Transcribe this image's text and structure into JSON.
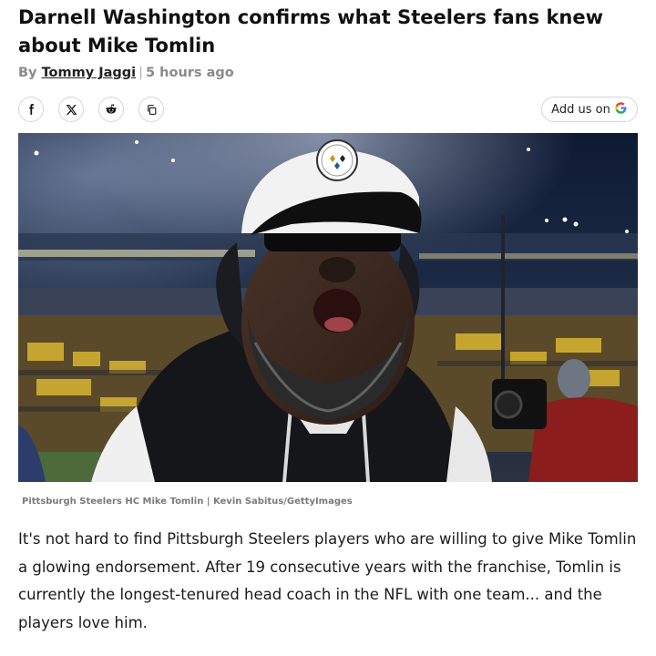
{
  "article": {
    "headline": "Darnell Washington confirms what Steelers fans knew about Mike Tomlin",
    "byline_prefix": "By",
    "author": "Tommy Jaggi",
    "separator": "|",
    "time_ago": "5 hours ago"
  },
  "share": {
    "buttons": [
      {
        "name": "facebook-share-button",
        "icon": "facebook-icon"
      },
      {
        "name": "x-share-button",
        "icon": "x-icon"
      },
      {
        "name": "reddit-share-button",
        "icon": "reddit-icon"
      },
      {
        "name": "copy-link-button",
        "icon": "copy-icon"
      }
    ],
    "add_us_label": "Add us on",
    "add_us_icon": "google-icon",
    "add_us_letter": "G"
  },
  "image": {
    "caption": "Pittsburgh Steelers HC Mike Tomlin | Kevin Sabitus/GettyImages"
  },
  "body": {
    "paragraph": "It's not hard to find Pittsburgh Steelers players who are willing to give Mike Tomlin a glowing endorsement. After 19 consecutive years with the franchise, Tomlin is currently the longest-tenured head coach in the NFL with one team... and the players love him."
  },
  "colors": {
    "headline": "#111111",
    "meta": "#8a8a8a",
    "border": "#d5d5d5",
    "google_blue": "#4285F4",
    "google_red": "#EA4335",
    "google_yellow": "#FBBC05",
    "google_green": "#34A853"
  }
}
